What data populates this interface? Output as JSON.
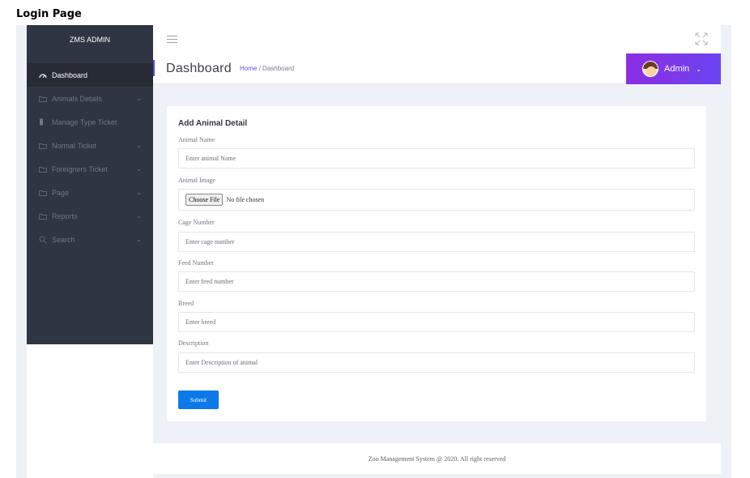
{
  "caption": "Login Page",
  "sidebar": {
    "brand": "ZMS ADMIN",
    "items": [
      {
        "label": "Dashboard",
        "icon": "dashboard-icon",
        "has_chevron": false
      },
      {
        "label": "Animals Details",
        "icon": "folder-icon",
        "has_chevron": true
      },
      {
        "label": "Manage Type Ticket",
        "icon": "bookmark-icon",
        "has_chevron": false
      },
      {
        "label": "Normal Ticket",
        "icon": "folder-icon",
        "has_chevron": true
      },
      {
        "label": "Foreigners Ticket",
        "icon": "folder-icon",
        "has_chevron": true
      },
      {
        "label": "Page",
        "icon": "folder-icon",
        "has_chevron": true
      },
      {
        "label": "Reports",
        "icon": "folder-icon",
        "has_chevron": true
      },
      {
        "label": "Search",
        "icon": "search-icon",
        "has_chevron": true
      }
    ]
  },
  "header": {
    "title": "Dashboard",
    "breadcrumb_home": "Home",
    "breadcrumb_sep": "/",
    "breadcrumb_current": "Dashboard",
    "user_label": "Admin"
  },
  "form": {
    "title": "Add Animal Detail",
    "fields": {
      "animal_name": {
        "label": "Animal Name",
        "placeholder": "Enter animal Name"
      },
      "animal_image": {
        "label": "Animal Image",
        "button": "Choose File",
        "status": "No file chosen"
      },
      "cage_number": {
        "label": "Cage Number",
        "placeholder": "Enter cage number"
      },
      "feed_number": {
        "label": "Feed Number",
        "placeholder": "Enter feed number"
      },
      "breed": {
        "label": "Breed",
        "placeholder": "Enter breed"
      },
      "description": {
        "label": "Description",
        "placeholder": "Enter Description of animal"
      }
    },
    "submit_label": "Submit"
  },
  "footer": {
    "text": "Zoo Management System @ 2020. All right reserved"
  },
  "colors": {
    "sidebar_bg": "#2f3542",
    "accent_purple": "#8e2de2",
    "submit_blue": "#0d79e8",
    "content_bg": "#eef1f5"
  }
}
